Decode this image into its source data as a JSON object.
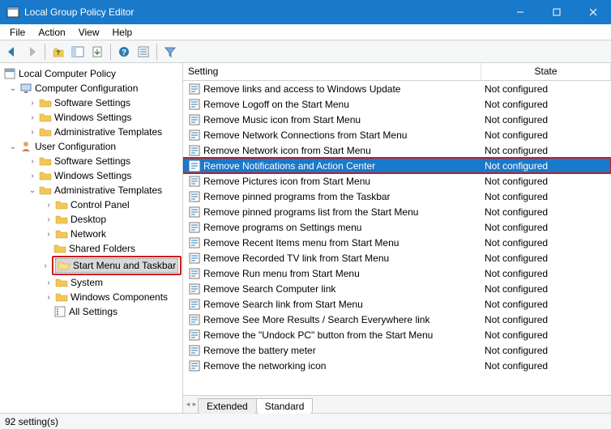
{
  "window": {
    "title": "Local Group Policy Editor"
  },
  "menu": {
    "file": "File",
    "action": "Action",
    "view": "View",
    "help": "Help"
  },
  "tree": {
    "root": "Local Computer Policy",
    "computer_config": "Computer Configuration",
    "cc_software": "Software Settings",
    "cc_windows": "Windows Settings",
    "cc_admin": "Administrative Templates",
    "user_config": "User Configuration",
    "uc_software": "Software Settings",
    "uc_windows": "Windows Settings",
    "uc_admin": "Administrative Templates",
    "control_panel": "Control Panel",
    "desktop": "Desktop",
    "network": "Network",
    "shared_folders": "Shared Folders",
    "start_menu": "Start Menu and Taskbar",
    "system": "System",
    "win_components": "Windows Components",
    "all_settings": "All Settings"
  },
  "list": {
    "col_setting": "Setting",
    "col_state": "State",
    "rows": [
      {
        "setting": "Remove links and access to Windows Update",
        "state": "Not configured"
      },
      {
        "setting": "Remove Logoff on the Start Menu",
        "state": "Not configured"
      },
      {
        "setting": "Remove Music icon from Start Menu",
        "state": "Not configured"
      },
      {
        "setting": "Remove Network Connections from Start Menu",
        "state": "Not configured"
      },
      {
        "setting": "Remove Network icon from Start Menu",
        "state": "Not configured"
      },
      {
        "setting": "Remove Notifications and Action Center",
        "state": "Not configured"
      },
      {
        "setting": "Remove Pictures icon from Start Menu",
        "state": "Not configured"
      },
      {
        "setting": "Remove pinned programs from the Taskbar",
        "state": "Not configured"
      },
      {
        "setting": "Remove pinned programs list from the Start Menu",
        "state": "Not configured"
      },
      {
        "setting": "Remove programs on Settings menu",
        "state": "Not configured"
      },
      {
        "setting": "Remove Recent Items menu from Start Menu",
        "state": "Not configured"
      },
      {
        "setting": "Remove Recorded TV link from Start Menu",
        "state": "Not configured"
      },
      {
        "setting": "Remove Run menu from Start Menu",
        "state": "Not configured"
      },
      {
        "setting": "Remove Search Computer link",
        "state": "Not configured"
      },
      {
        "setting": "Remove Search link from Start Menu",
        "state": "Not configured"
      },
      {
        "setting": "Remove See More Results / Search Everywhere link",
        "state": "Not configured"
      },
      {
        "setting": "Remove the \"Undock PC\" button from the Start Menu",
        "state": "Not configured"
      },
      {
        "setting": "Remove the battery meter",
        "state": "Not configured"
      },
      {
        "setting": "Remove the networking icon",
        "state": "Not configured"
      }
    ]
  },
  "tabs": {
    "extended": "Extended",
    "standard": "Standard"
  },
  "status": {
    "text": "92 setting(s)"
  }
}
